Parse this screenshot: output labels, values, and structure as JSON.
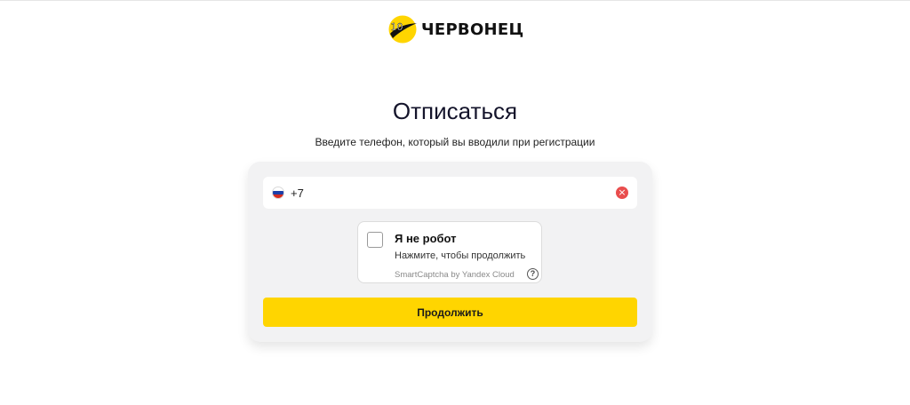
{
  "brand": {
    "name": "ЧЕРВОНЕЦ",
    "logo_numeral": "10",
    "logo_colors": {
      "coin": "#ffd500",
      "swoosh": "#111111"
    }
  },
  "page": {
    "title": "Отписаться",
    "subtitle": "Введите телефон, который вы вводили при регистрации"
  },
  "phone_field": {
    "value": "+7",
    "country_icon": "russia-flag-icon",
    "clear_icon": "clear-icon",
    "clear_color": "#e94d4d"
  },
  "captcha": {
    "label": "Я не робот",
    "hint": "Нажмите, чтобы продолжить",
    "brand": "SmartCaptcha by Yandex Cloud",
    "help_glyph": "?",
    "checked": false
  },
  "actions": {
    "continue_label": "Продолжить",
    "accent_color": "#ffd500"
  }
}
